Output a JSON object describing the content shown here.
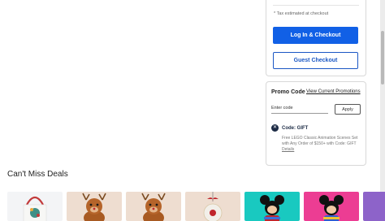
{
  "checkout": {
    "tax_note": "* Tax estimated at checkout",
    "login_checkout_label": "Log In & Checkout",
    "guest_checkout_label": "Guest Checkout"
  },
  "promo": {
    "title": "Promo Code",
    "view_promotions_link": "View Current Promotions",
    "input_placeholder": "Enter code",
    "apply_label": "Apply",
    "applied_code_label": "Code: GIFT",
    "applied_code_description": "Free LEGO Classic Animation Scenes Set with Any Order of $150+ with Code: GIFT",
    "details_link": "Details"
  },
  "deals": {
    "heading": "Can't Miss Deals",
    "tiles": [
      {
        "item": "tote-bag",
        "bg": "#f3f4f6"
      },
      {
        "item": "reindeer-plush",
        "bg": "#eeddd0"
      },
      {
        "item": "reindeer-plush",
        "bg": "#eeddd0"
      },
      {
        "item": "ornament",
        "bg": "#eeddd0"
      },
      {
        "item": "mickey-plush-teal",
        "bg": "#19c9c0"
      },
      {
        "item": "mickey-plush-pink",
        "bg": "#ec3d93"
      },
      {
        "item": "partial-tile",
        "bg": "#8d63c9"
      }
    ]
  },
  "colors": {
    "primary_button": "#1160e6",
    "guest_border": "#1b57c4",
    "code_icon": "#1c2b45"
  }
}
